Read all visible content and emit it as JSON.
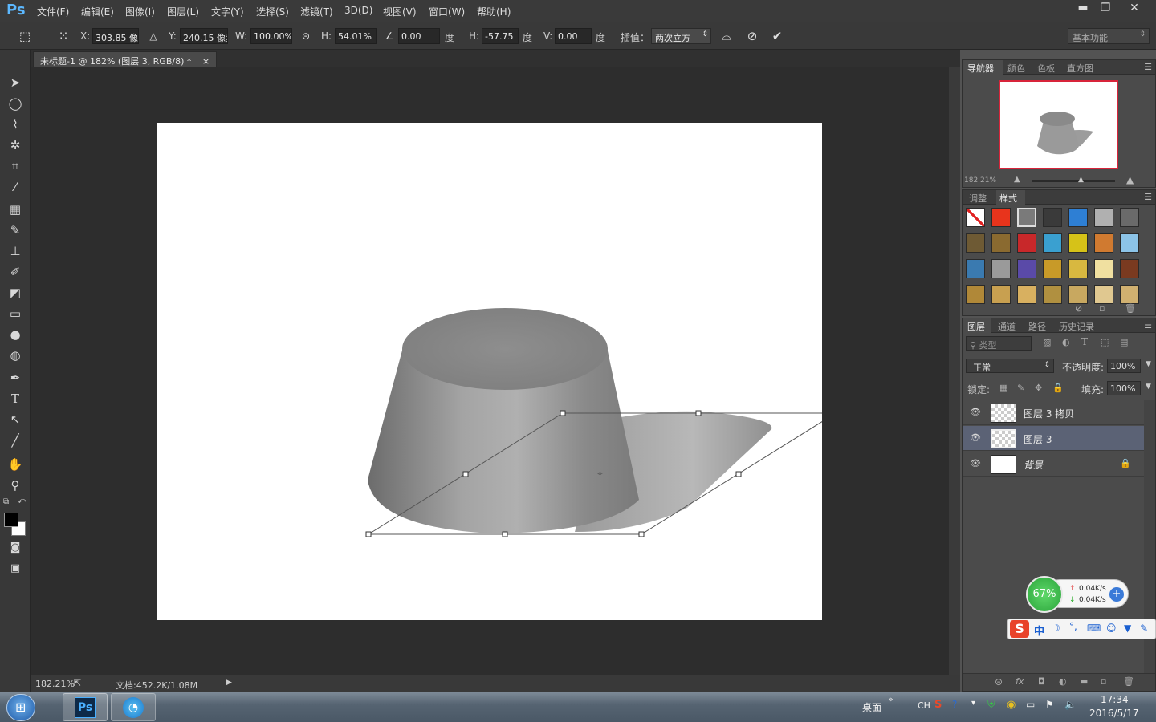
{
  "app": {
    "logo": "Ps"
  },
  "menu": [
    "文件(F)",
    "编辑(E)",
    "图像(I)",
    "图层(L)",
    "文字(Y)",
    "选择(S)",
    "滤镜(T)",
    "3D(D)",
    "视图(V)",
    "窗口(W)",
    "帮助(H)"
  ],
  "window_controls": {
    "minimize": "▬",
    "restore": "❐",
    "close": "✕"
  },
  "options": {
    "x_label": "X:",
    "x_value": "303.85 像素",
    "y_label": "Y:",
    "y_value": "240.15 像素",
    "w_label": "W:",
    "w_value": "100.00%",
    "h_label": "H:",
    "h_value": "54.01%",
    "angle_value": "0.00",
    "angle_unit": "度",
    "hskew_label": "H:",
    "hskew_value": "-57.75",
    "hskew_unit": "度",
    "vskew_label": "V:",
    "vskew_value": "0.00",
    "vskew_unit": "度",
    "interp_label": "插值：",
    "interp_value": "两次立方",
    "workspace": "基本功能"
  },
  "document": {
    "tab_title": "未标题-1 @ 182% (图层 3, RGB/8) *",
    "tab_close": "×",
    "zoom": "182.21%",
    "doc_info": "文档:452.2K/1.08M"
  },
  "navigator": {
    "tabs": [
      "导航器",
      "颜色",
      "色板",
      "直方图"
    ],
    "zoom": "182.21%"
  },
  "styles_panel": {
    "tabs": [
      "调整",
      "样式"
    ],
    "swatch_colors": [
      "#ffffff",
      "#e8341c",
      "#7a7a7a",
      "#3a3a3a",
      "#2e7fd4",
      "#b0b0b0",
      "#6a6a6a",
      "#6e5a34",
      "#8a6a30",
      "#c8282a",
      "#3aa0d0",
      "#d6c218",
      "#d07a30",
      "#8cc4e8",
      "#3a7ab0",
      "#9a9a9a",
      "#5a4aa8",
      "#c89a28",
      "#d8b840",
      "#f0e0a0",
      "#7a3a20",
      "#b08838",
      "#c8a050",
      "#d8b060",
      "#b09040",
      "#c8a860",
      "#e0c890",
      "#d0b070"
    ]
  },
  "layers_panel": {
    "tabs": [
      "图层",
      "通道",
      "路径",
      "历史记录"
    ],
    "filter_label": "类型",
    "blend_mode": "正常",
    "opacity_label": "不透明度:",
    "opacity_value": "100%",
    "lock_label": "锁定:",
    "fill_label": "填充:",
    "fill_value": "100%",
    "layers": [
      {
        "name": "图层 3 拷贝",
        "selected": false
      },
      {
        "name": "图层 3",
        "selected": true
      },
      {
        "name": "背景",
        "selected": false
      }
    ]
  },
  "net_widget": {
    "percent": "67%",
    "up": "0.04K/s",
    "down": "0.04K/s"
  },
  "ime": {
    "mode": "中"
  },
  "taskbar": {
    "desktop_label": "桌面",
    "lang": "CH",
    "time": "17:34",
    "date": "2016/5/17"
  }
}
